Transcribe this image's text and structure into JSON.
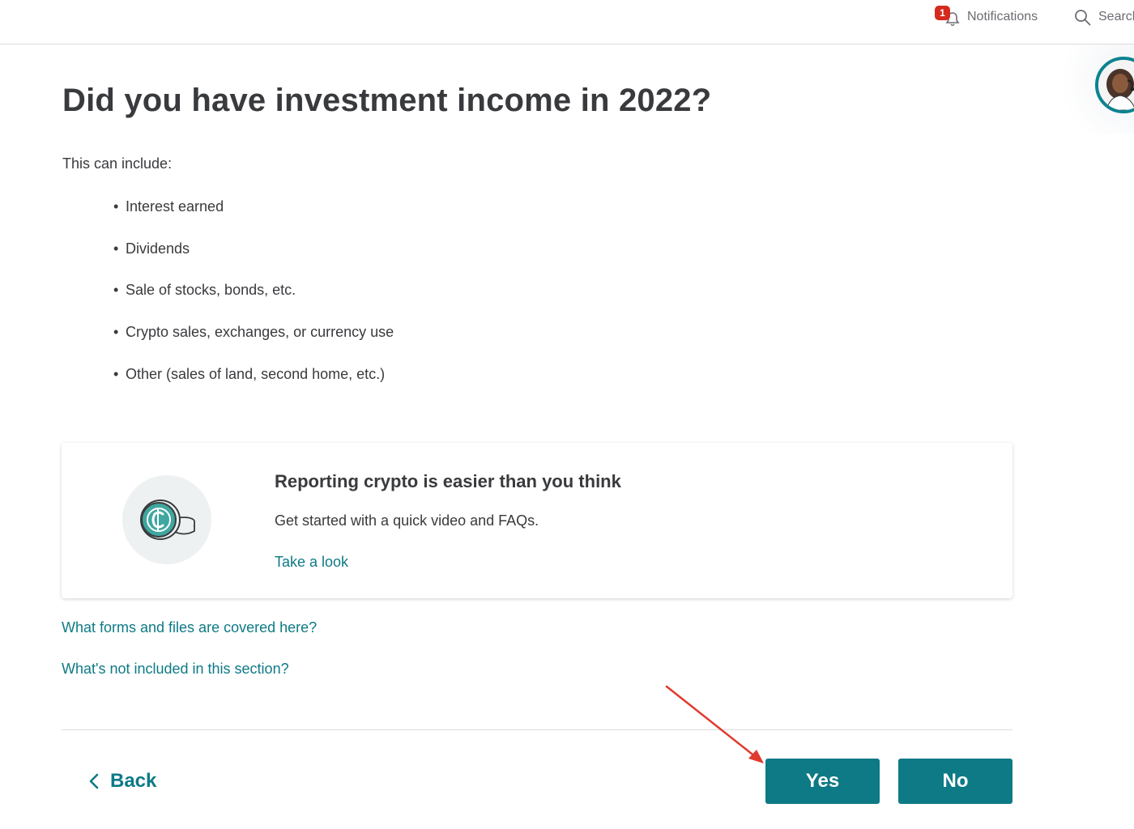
{
  "header": {
    "notifications_label": "Notifications",
    "notifications_count": "1",
    "search_label": "Search"
  },
  "page": {
    "title": "Did you have investment income in 2022?",
    "intro": "This can include:",
    "bullets": [
      "Interest earned",
      "Dividends",
      "Sale of stocks, bonds, etc.",
      "Crypto sales, exchanges, or currency use",
      "Other (sales of land, second home, etc.)"
    ]
  },
  "crypto_card": {
    "title": "Reporting crypto is easier than you think",
    "body": "Get started with a quick video and FAQs.",
    "link": "Take a look",
    "icon": "crypto-coin-icon"
  },
  "help_links": {
    "forms": "What forms and files are covered here?",
    "not_included": "What's not included in this section?"
  },
  "footer": {
    "back_label": "Back",
    "yes_label": "Yes",
    "no_label": "No"
  },
  "colors": {
    "primary": "#0d7a86",
    "text": "#393a3d",
    "badge": "#d52b1e",
    "annotation_arrow": "#e03a2f"
  }
}
